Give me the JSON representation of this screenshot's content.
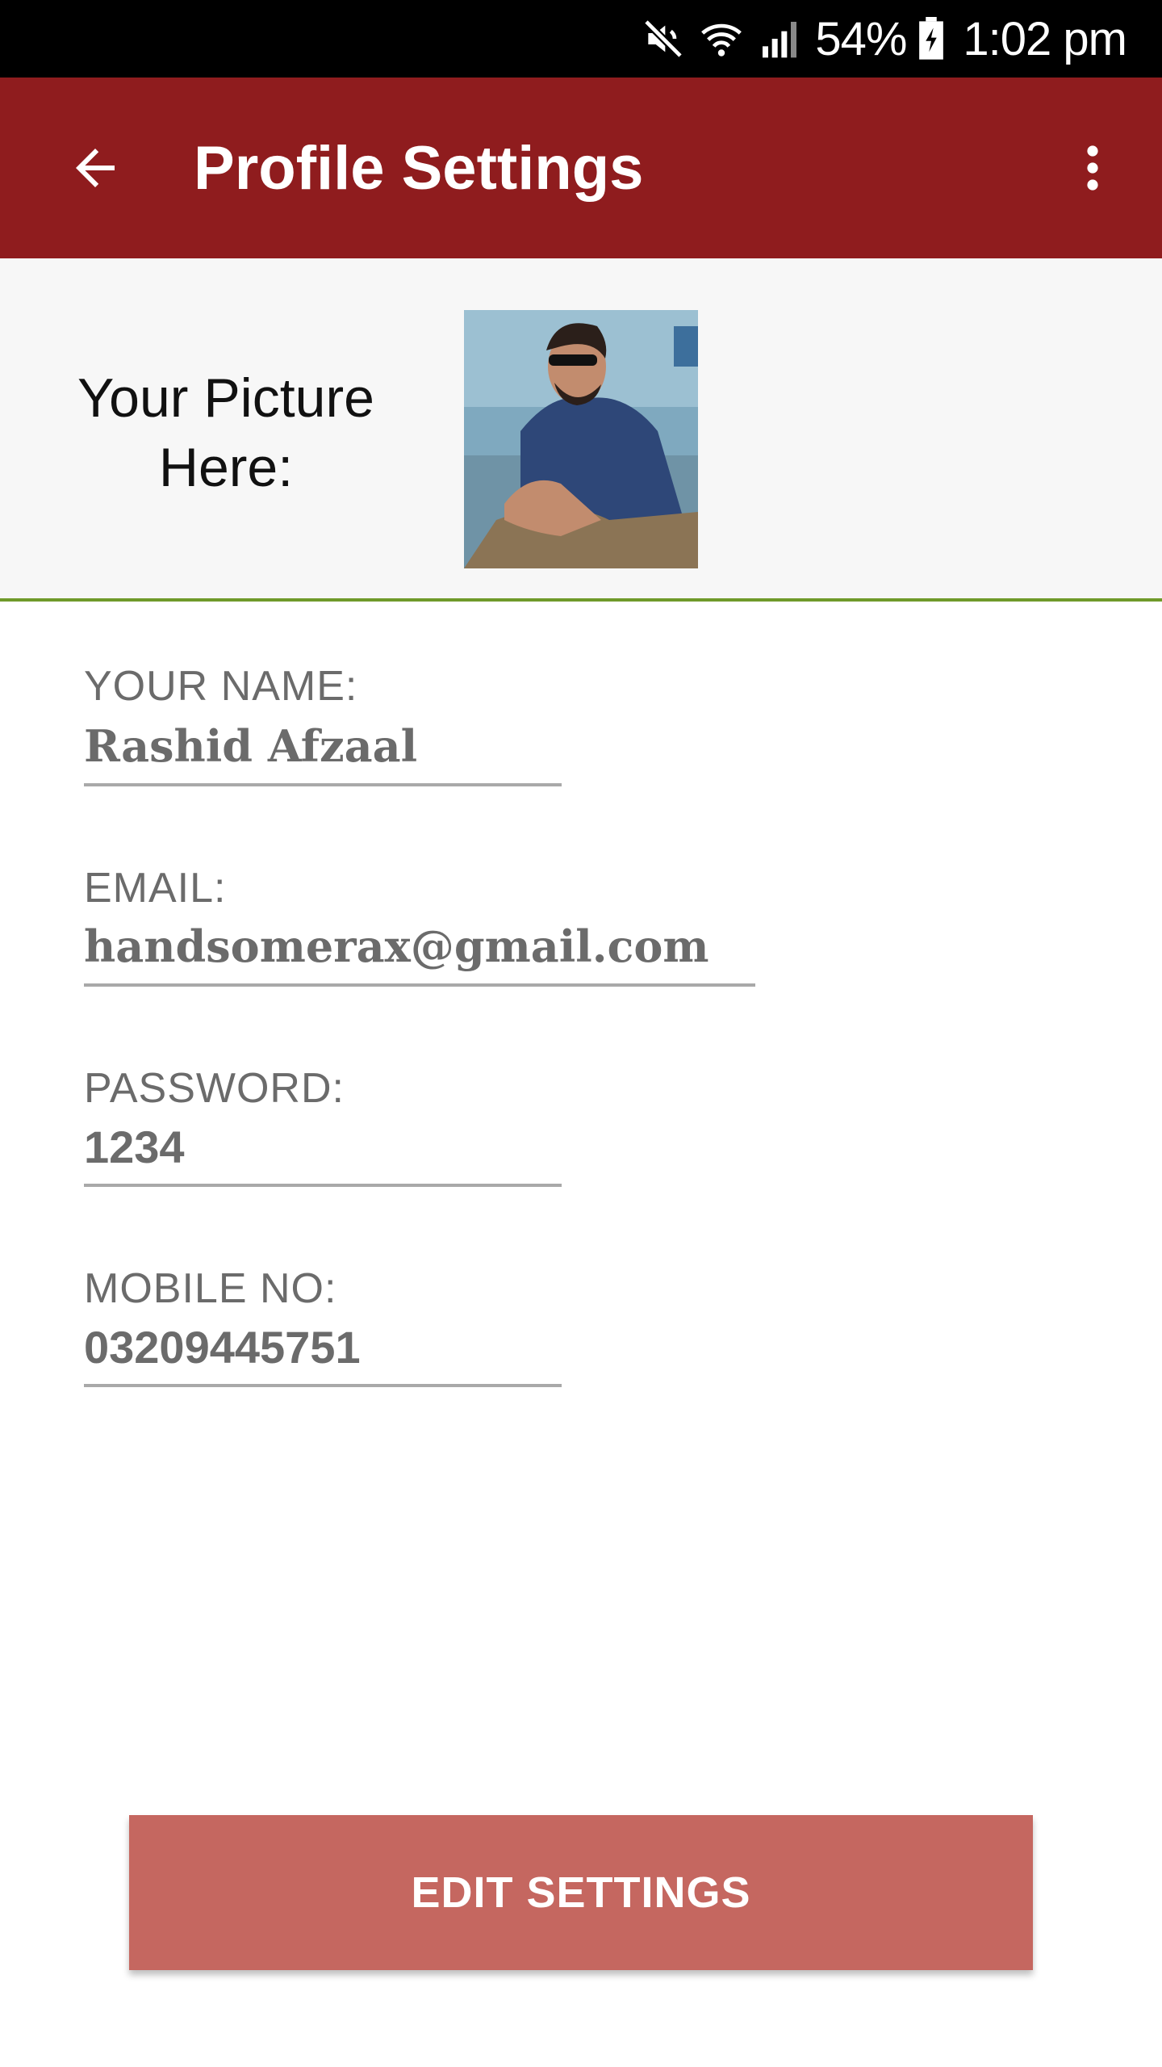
{
  "status_bar": {
    "battery_percent": "54%",
    "time": "1:02 pm",
    "icons": [
      "mute-icon",
      "wifi-icon",
      "signal-icon",
      "battery-icon"
    ]
  },
  "app_bar": {
    "title": "Profile Settings",
    "back_icon": "arrow-back-icon",
    "menu_icon": "more-vert-icon",
    "color": "#8f1c1e"
  },
  "picture": {
    "label": "Your Picture Here:"
  },
  "form": {
    "name": {
      "label": "YOUR NAME:",
      "value": "Rashid Afzaal"
    },
    "email": {
      "label": "EMAIL:",
      "value": "handsomerax@gmail.com"
    },
    "password": {
      "label": "PASSWORD:",
      "value": "1234"
    },
    "mobile": {
      "label": "MOBILE NO:",
      "value": "03209445751"
    }
  },
  "actions": {
    "edit_label": "EDIT SETTINGS",
    "color": "#c56760"
  }
}
